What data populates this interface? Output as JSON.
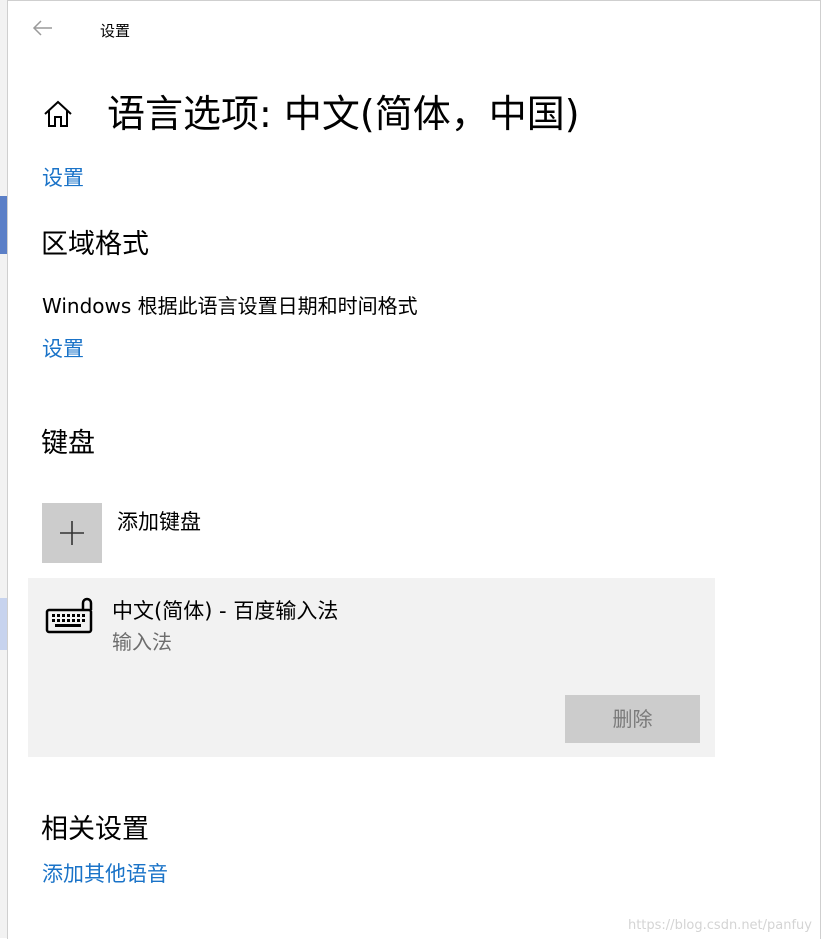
{
  "window": {
    "app_title": "设置",
    "page_title": "语言选项: 中文(简体，中国)"
  },
  "language_settings_link": "设置",
  "region_format": {
    "title": "区域格式",
    "description": "Windows 根据此语言设置日期和时间格式",
    "settings_link": "设置"
  },
  "keyboards": {
    "title": "键盘",
    "add_label": "添加键盘",
    "items": [
      {
        "name": "中文(简体) - 百度输入法",
        "type": "输入法",
        "delete_label": "删除"
      }
    ]
  },
  "related": {
    "title": "相关设置",
    "add_language_link": "添加其他语音"
  },
  "watermark": "https://blog.csdn.net/panfuy",
  "colors": {
    "link": "#1a73c8",
    "card_bg": "#f2f2f2",
    "button_bg": "#cccccc"
  },
  "icons": [
    "back-arrow-icon",
    "home-icon",
    "plus-icon",
    "keyboard-icon"
  ]
}
